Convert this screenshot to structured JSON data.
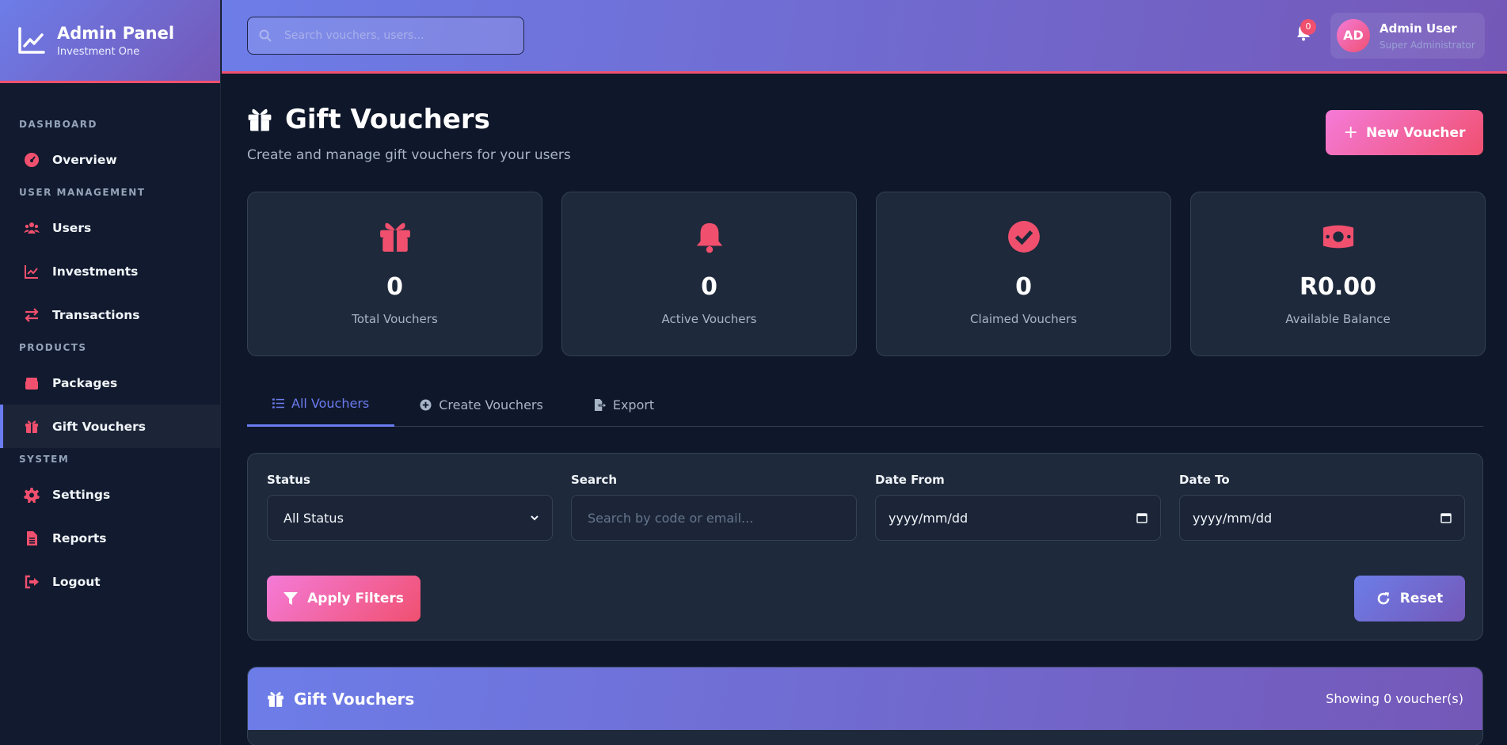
{
  "brand": {
    "title": "Admin Panel",
    "subtitle": "Investment One"
  },
  "sidebar": {
    "sections": [
      {
        "label": "DASHBOARD",
        "items": [
          {
            "label": "Overview",
            "icon": "gauge-icon"
          }
        ]
      },
      {
        "label": "USER MANAGEMENT",
        "items": [
          {
            "label": "Users",
            "icon": "users-icon"
          },
          {
            "label": "Investments",
            "icon": "chart-line-icon"
          },
          {
            "label": "Transactions",
            "icon": "exchange-icon"
          }
        ]
      },
      {
        "label": "PRODUCTS",
        "items": [
          {
            "label": "Packages",
            "icon": "box-icon"
          },
          {
            "label": "Gift Vouchers",
            "icon": "gift-icon",
            "active": true
          }
        ]
      },
      {
        "label": "SYSTEM",
        "items": [
          {
            "label": "Settings",
            "icon": "gear-icon"
          },
          {
            "label": "Reports",
            "icon": "file-icon"
          },
          {
            "label": "Logout",
            "icon": "logout-icon"
          }
        ]
      }
    ]
  },
  "topbar": {
    "search_placeholder": "Search vouchers, users...",
    "notification_count": "0",
    "user": {
      "initials": "AD",
      "name": "Admin User",
      "role": "Super Administrator"
    }
  },
  "page": {
    "title": "Gift Vouchers",
    "subtitle": "Create and manage gift vouchers for your users",
    "new_button": "New Voucher"
  },
  "stats": [
    {
      "value": "0",
      "label": "Total Vouchers",
      "icon": "gift-icon"
    },
    {
      "value": "0",
      "label": "Active Vouchers",
      "icon": "bell-icon"
    },
    {
      "value": "0",
      "label": "Claimed Vouchers",
      "icon": "check-circle-icon"
    },
    {
      "value": "R0.00",
      "label": "Available Balance",
      "icon": "money-icon"
    }
  ],
  "tabs": [
    {
      "label": "All Vouchers",
      "icon": "list-icon",
      "active": true
    },
    {
      "label": "Create Vouchers",
      "icon": "plus-circle-icon"
    },
    {
      "label": "Export",
      "icon": "export-icon"
    }
  ],
  "filters": {
    "status": {
      "label": "Status",
      "value": "All Status"
    },
    "search": {
      "label": "Search",
      "placeholder": "Search by code or email..."
    },
    "date_from": {
      "label": "Date From",
      "value": "yyyy/mm/dd"
    },
    "date_to": {
      "label": "Date To",
      "value": "yyyy/mm/dd"
    },
    "apply_button": "Apply Filters",
    "reset_button": "Reset"
  },
  "table": {
    "title": "Gift Vouchers",
    "count_text": "Showing 0 voucher(s)"
  },
  "colors": {
    "accent": "#f0506e",
    "primary": "#6b7cf0",
    "background": "#0f172a",
    "card": "#1e293b"
  }
}
